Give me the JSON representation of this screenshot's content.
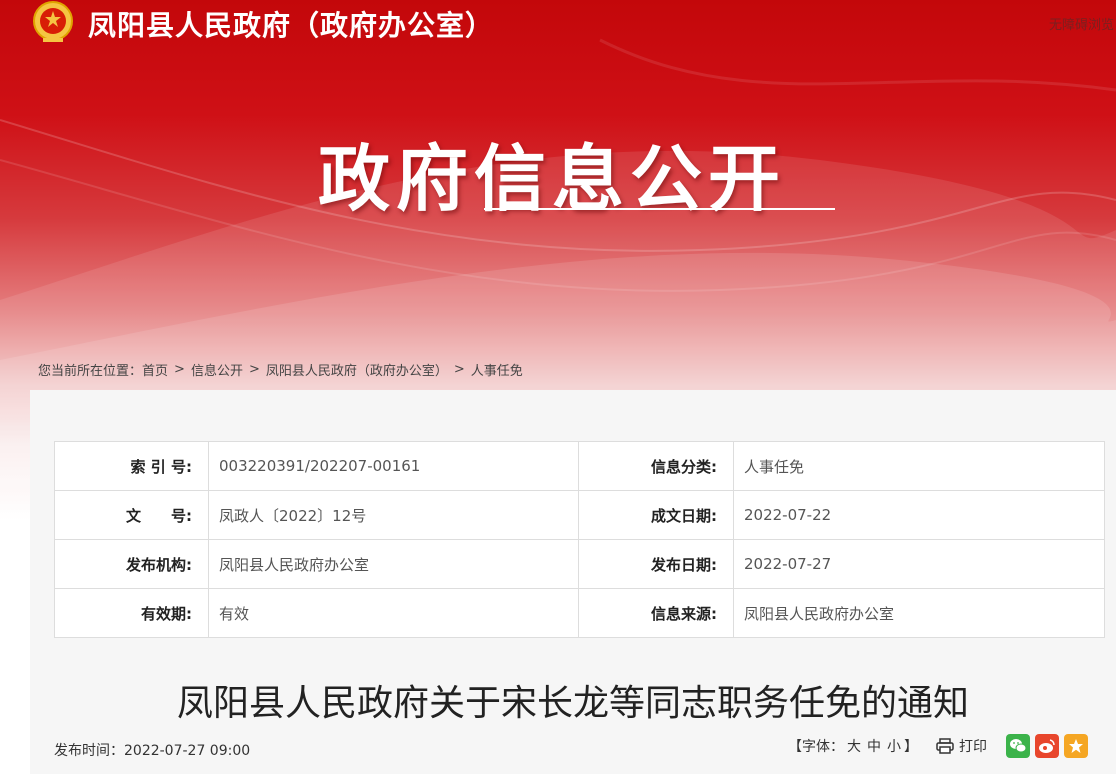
{
  "header": {
    "site_title": "凤阳县人民政府（政府办公室）",
    "accessibility_link": "无障碍浏览"
  },
  "banner": {
    "hero_title": "政府信息公开"
  },
  "breadcrumb": {
    "prefix": "您当前所在位置：",
    "separator": ">",
    "items": [
      "首页",
      "信息公开",
      "凤阳县人民政府（政府办公室）",
      "人事任免"
    ]
  },
  "meta": {
    "rows": [
      {
        "label1": "索 引 号:",
        "value1": "003220391/202207-00161",
        "label2": "信息分类:",
        "value2": "人事任免"
      },
      {
        "label1": "文　　号:",
        "value1": "凤政人〔2022〕12号",
        "label2": "成文日期:",
        "value2": "2022-07-22"
      },
      {
        "label1": "发布机构:",
        "value1": "凤阳县人民政府办公室",
        "label2": "发布日期:",
        "value2": "2022-07-27"
      },
      {
        "label1": "有效期:",
        "value1": "有效",
        "label2": "信息来源:",
        "value2": "凤阳县人民政府办公室"
      }
    ]
  },
  "document": {
    "title": "凤阳县人民政府关于宋长龙等同志职务任免的通知",
    "publish_time": "发布时间：2022-07-27 09:00"
  },
  "tools": {
    "font_label": "【字体：",
    "font_large": "大",
    "font_medium": "中",
    "font_small": "小",
    "font_close": "】",
    "print_label": "打印"
  },
  "colors": {
    "brand_red": "#c3070a",
    "wechat": "#3bb34a",
    "weibo": "#e8462c",
    "favorite": "#f5a623"
  },
  "icons": [
    "national-emblem-icon",
    "print-icon",
    "wechat-icon",
    "weibo-icon",
    "favorite-icon"
  ]
}
